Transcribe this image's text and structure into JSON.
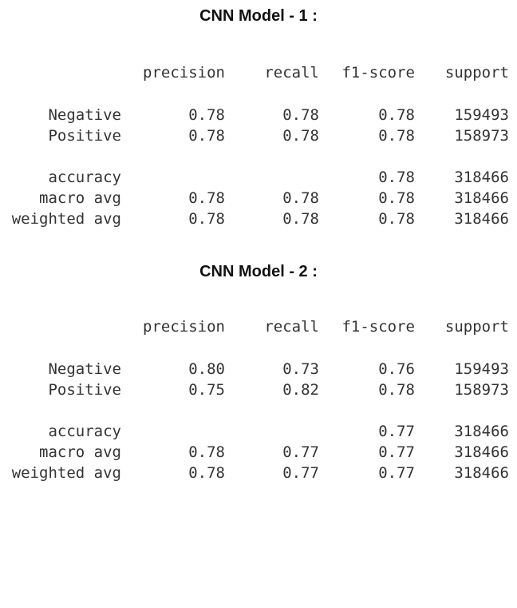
{
  "reports": [
    {
      "title": "CNN Model - 1 :",
      "headers": {
        "precision": "precision",
        "recall": "recall",
        "f1": "f1-score",
        "support": "support"
      },
      "rows": {
        "negative": {
          "label": "Negative",
          "precision": "0.78",
          "recall": "0.78",
          "f1": "0.78",
          "support": "159493"
        },
        "positive": {
          "label": "Positive",
          "precision": "0.78",
          "recall": "0.78",
          "f1": "0.78",
          "support": "158973"
        },
        "accuracy": {
          "label": "accuracy",
          "f1": "0.78",
          "support": "318466"
        },
        "macro": {
          "label": "macro avg",
          "precision": "0.78",
          "recall": "0.78",
          "f1": "0.78",
          "support": "318466"
        },
        "weighted": {
          "label": "weighted avg",
          "precision": "0.78",
          "recall": "0.78",
          "f1": "0.78",
          "support": "318466"
        }
      }
    },
    {
      "title": "CNN Model - 2 :",
      "headers": {
        "precision": "precision",
        "recall": "recall",
        "f1": "f1-score",
        "support": "support"
      },
      "rows": {
        "negative": {
          "label": "Negative",
          "precision": "0.80",
          "recall": "0.73",
          "f1": "0.76",
          "support": "159493"
        },
        "positive": {
          "label": "Positive",
          "precision": "0.75",
          "recall": "0.82",
          "f1": "0.78",
          "support": "158973"
        },
        "accuracy": {
          "label": "accuracy",
          "f1": "0.77",
          "support": "318466"
        },
        "macro": {
          "label": "macro avg",
          "precision": "0.78",
          "recall": "0.77",
          "f1": "0.77",
          "support": "318466"
        },
        "weighted": {
          "label": "weighted avg",
          "precision": "0.78",
          "recall": "0.77",
          "f1": "0.77",
          "support": "318466"
        }
      }
    }
  ]
}
